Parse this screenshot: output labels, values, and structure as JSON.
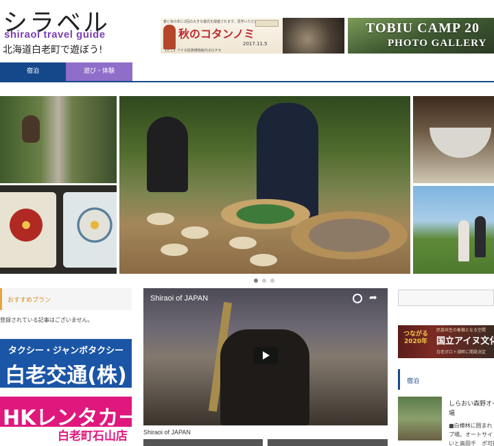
{
  "header": {
    "logo_main": "シラベル",
    "logo_sub": "shiraoi travel guide",
    "logo_tagline": "北海道白老町で遊ぼう!",
    "banner_kotan": {
      "top_text": "春と秋の年に2回の大きな儀式を開催されます。見学いただけます!",
      "title": "秋のコタンノミ",
      "date": "2017.11.5",
      "bottom_text": "【とこ】アイヌ民族博物館内ポロチセ"
    },
    "banner_tobiu": {
      "line1": "TOBIU CAMP 20",
      "line2": "PHOTO GALLERY"
    }
  },
  "nav": {
    "items": [
      {
        "label": "宿泊"
      },
      {
        "label": "遊び・体験"
      }
    ]
  },
  "slider": {
    "dots": 3,
    "active_dot": 1
  },
  "left": {
    "recommend_title": "おすすめプラン",
    "recommend_empty": "登録されている記事はございません。",
    "ad_taxi": {
      "line1": "タクシー・ジャンボタクシー",
      "line2": "白老交通(株)"
    },
    "ad_hk": {
      "line1": "HKレンタカー",
      "line2": "白老町石山店"
    }
  },
  "video": {
    "title": "Shiraoi of JAPAN",
    "caption": "Shiraoi of JAPAN"
  },
  "right": {
    "ainu_ad": {
      "small": "民族共生の象徴となる空間",
      "year": "つながる 2020年",
      "main": "国立アイヌ文化",
      "bottom": "白老ポロト湖畔に開設決定"
    },
    "stay_title": "宿泊",
    "stay_item_title": "しらおい森野オー\n場",
    "stay_item_body": "■白樺林に囲まれ\nプ場。オートサイト\nいと高田千　ポ可能で"
  },
  "colors": {
    "nav_blue": "#15488a",
    "nav_purple": "#8f6ec9",
    "accent_orange": "#e8a33d",
    "taxi_blue": "#1b55a6",
    "hk_pink": "#e0177d"
  }
}
